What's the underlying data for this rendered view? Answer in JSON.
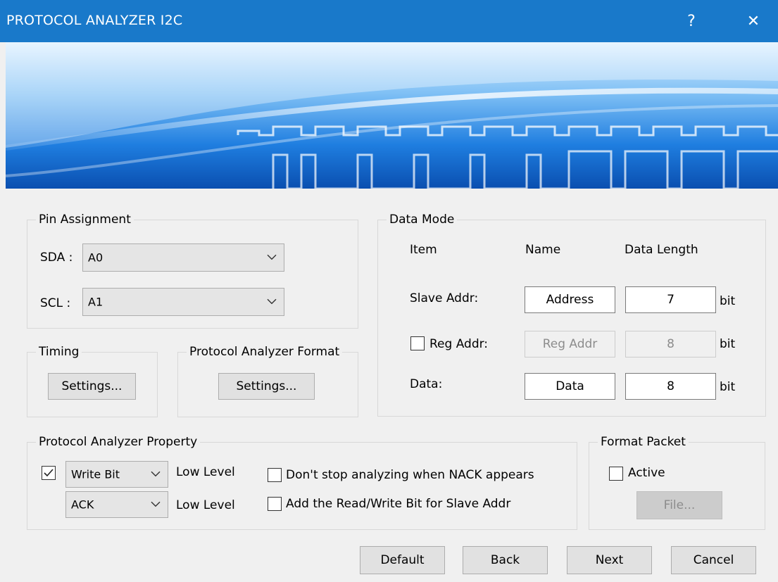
{
  "window": {
    "title": "PROTOCOL ANALYZER I2C",
    "help_glyph": "?",
    "close_glyph": "✕"
  },
  "pin_assignment": {
    "label": "Pin Assignment",
    "sda_label": "SDA :",
    "sda_value": "A0",
    "scl_label": "SCL :",
    "scl_value": "A1"
  },
  "timing": {
    "label": "Timing",
    "button": "Settings..."
  },
  "format": {
    "label": "Protocol Analyzer Format",
    "button": "Settings..."
  },
  "data_mode": {
    "label": "Data Mode",
    "headers": {
      "item": "Item",
      "name": "Name",
      "length": "Data Length"
    },
    "rows": [
      {
        "label": "Slave Addr:",
        "name": "Address",
        "length": "7",
        "unit": "bit",
        "enabled": true
      },
      {
        "label": "Reg Addr:",
        "name": "Reg Addr",
        "length": "8",
        "unit": "bit",
        "enabled": false,
        "checked": false
      },
      {
        "label": "Data:",
        "name": "Data",
        "length": "8",
        "unit": "bit",
        "enabled": true
      }
    ]
  },
  "property": {
    "label": "Protocol Analyzer Property",
    "bit_checked": true,
    "bit_value": "Write Bit",
    "bit_level": "Low Level",
    "ack_value": "ACK",
    "ack_level": "Low Level",
    "nack_option": "Don't stop analyzing  when NACK appears",
    "rw_option": "Add the Read/Write Bit for Slave Addr"
  },
  "format_packet": {
    "label": "Format Packet",
    "active_label": "Active",
    "file_button": "File..."
  },
  "footer": {
    "default": "Default",
    "back": "Back",
    "next": "Next",
    "cancel": "Cancel"
  },
  "colors": {
    "titlebar": "#1979ca",
    "banner_dark": "#0a4fb0",
    "banner_light": "#dcefff"
  },
  "icons": [
    "help-icon",
    "close-icon",
    "chevron-down-icon",
    "checkmark-icon"
  ]
}
